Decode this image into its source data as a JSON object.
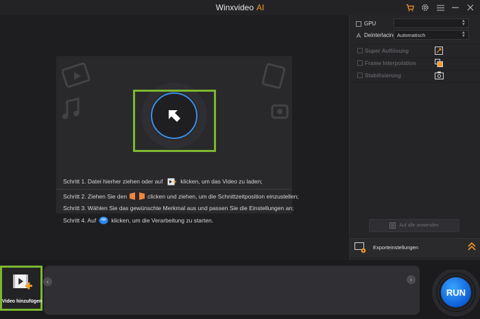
{
  "titlebar": {
    "app_name": "Winxvideo",
    "app_suffix": "AI"
  },
  "colors": {
    "accent_orange": "#f59a23",
    "focus_green": "#7cb82f",
    "run_blue": "#1f7ae8"
  },
  "dropzone": {
    "step1_a": "Schritt 1. Datei hierher ziehen oder auf",
    "step1_b": "klicken, um das Video zu laden;",
    "step2_a": "Schritt 2. Ziehen Sie den",
    "step2_b": "clicken und ziehen, um die Schnittzeitposition einzustellen;",
    "step3": "Schritt 3. Wählen Sie das gewünschte Merkmal aus und passen Sie die Einstellungen an;",
    "step4_a": "Schritt 4. Auf",
    "step4_b": "klicken, um die Verarbeitung zu starten."
  },
  "settings": {
    "gpu_label": "GPU",
    "gpu_value": "",
    "deinterlacing_label": "Deinterlacing",
    "deinterlacing_value": "Automatisch",
    "features": [
      {
        "label": "Super Auflösung",
        "icon": "upscale-icon"
      },
      {
        "label": "Frame Interpolation",
        "icon": "frames-icon"
      },
      {
        "label": "Stabilisierung",
        "icon": "camera-icon"
      }
    ],
    "apply_all": "Auf alle anwenden",
    "export_settings": "Exporteinstellungen"
  },
  "bottom": {
    "add_video": "Video hinzufügen",
    "run": "RUN"
  }
}
